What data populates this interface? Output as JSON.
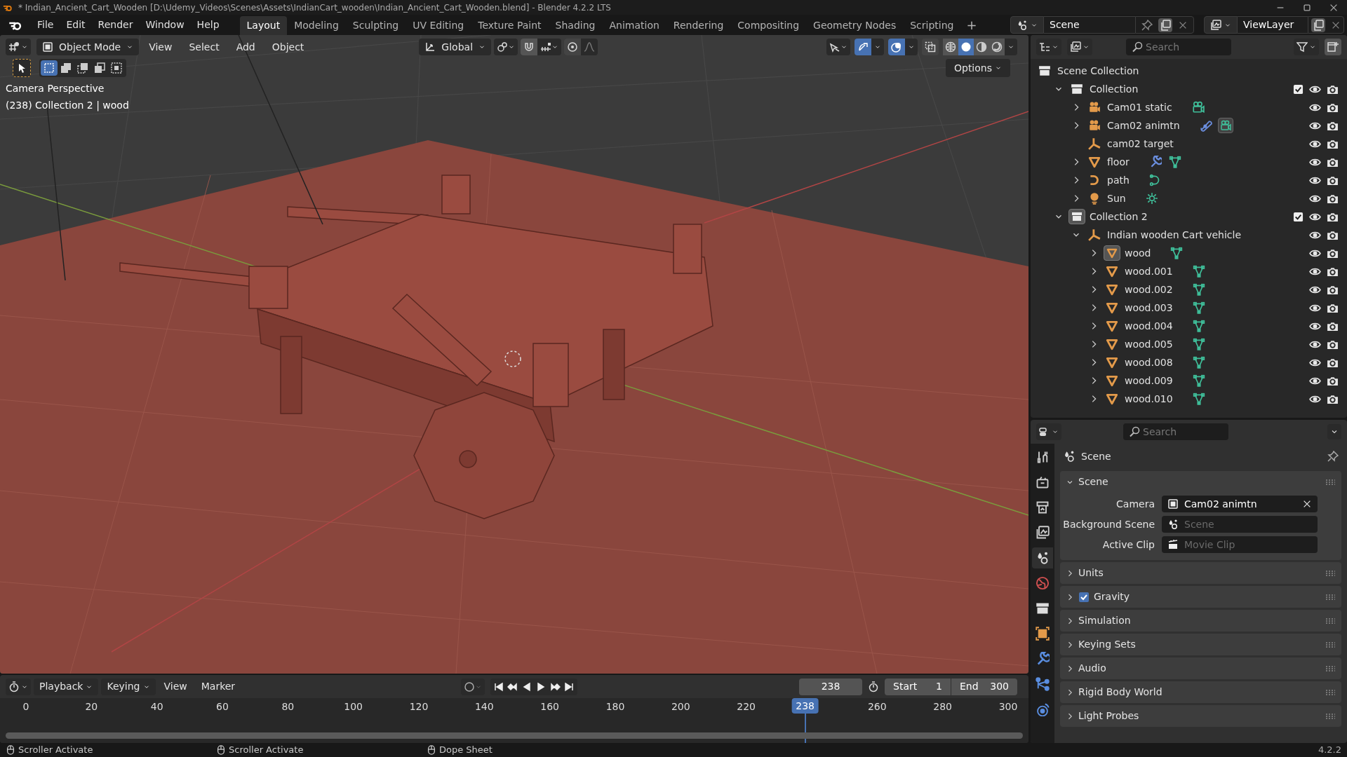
{
  "window": {
    "title": "* Indian_Ancient_Cart_Wooden [D:\\Udemy_Videos\\Scenes\\Assets\\IndianCart_wooden\\Indian_Ancient_Cart_Wooden.blend] - Blender 4.2.2 LTS"
  },
  "menu": [
    "File",
    "Edit",
    "Render",
    "Window",
    "Help"
  ],
  "workspaces": [
    {
      "label": "Layout",
      "selected": true
    },
    {
      "label": "Modeling",
      "selected": false
    },
    {
      "label": "Sculpting",
      "selected": false
    },
    {
      "label": "UV Editing",
      "selected": false
    },
    {
      "label": "Texture Paint",
      "selected": false
    },
    {
      "label": "Shading",
      "selected": false
    },
    {
      "label": "Animation",
      "selected": false
    },
    {
      "label": "Rendering",
      "selected": false
    },
    {
      "label": "Compositing",
      "selected": false
    },
    {
      "label": "Geometry Nodes",
      "selected": false
    },
    {
      "label": "Scripting",
      "selected": false
    }
  ],
  "add_workspace": "+",
  "scene": "Scene",
  "view_layer": "ViewLayer",
  "viewport": {
    "mode": "Object Mode",
    "menus": [
      "View",
      "Select",
      "Add",
      "Object"
    ],
    "orientation": "Global",
    "select_modes": [
      {
        "selected": true
      },
      {
        "selected": false
      },
      {
        "selected": false
      },
      {
        "selected": false
      },
      {
        "selected": false
      }
    ],
    "shading_modes": [
      {
        "kind": "wireframe",
        "selected": false
      },
      {
        "kind": "solid",
        "selected": true
      },
      {
        "kind": "material",
        "selected": false
      },
      {
        "kind": "rendered",
        "selected": false
      }
    ],
    "options": "Options",
    "info": [
      "Camera Perspective",
      "(238) Collection 2 | wood"
    ]
  },
  "outliner": {
    "search_placeholder": "Search",
    "tree": [
      {
        "label": "Scene Collection",
        "kind": "scene_collection",
        "active": false,
        "children": [
          {
            "label": "Collection",
            "kind": "collection",
            "active": false,
            "expanded": true,
            "checked": true,
            "children": [
              {
                "label": "Cam01 static",
                "kind": "camera",
                "active": false,
                "expanded": false,
                "extras": [
                  {
                    "kind": "camera_data",
                    "active": false
                  }
                ]
              },
              {
                "label": "Cam02 animtn",
                "kind": "camera",
                "active": false,
                "expanded": false,
                "extras": [
                  {
                    "kind": "constraint",
                    "active": false
                  },
                  {
                    "kind": "camera_data",
                    "active": true
                  }
                ]
              },
              {
                "label": "cam02 target",
                "kind": "empty",
                "active": false
              },
              {
                "label": "floor",
                "kind": "mesh",
                "active": false,
                "expanded": false,
                "extras": [
                  {
                    "kind": "modifier",
                    "active": false
                  },
                  {
                    "kind": "mesh_data",
                    "active": false
                  }
                ]
              },
              {
                "label": "path",
                "kind": "curve",
                "active": false,
                "expanded": false,
                "extras": [
                  {
                    "kind": "curve_data",
                    "active": false
                  }
                ]
              },
              {
                "label": "Sun",
                "kind": "light",
                "active": false,
                "expanded": false,
                "extras": [
                  {
                    "kind": "light_data",
                    "active": false
                  }
                ]
              }
            ]
          },
          {
            "label": "Collection 2",
            "kind": "collection",
            "active": true,
            "expanded": true,
            "checked": true,
            "children": [
              {
                "label": "Indian wooden Cart vehicle",
                "kind": "empty",
                "active": false,
                "expanded": true,
                "children": [
                  {
                    "label": "wood",
                    "kind": "mesh",
                    "active": true,
                    "expanded": false,
                    "extras": [
                      {
                        "kind": "mesh_data",
                        "active": false
                      }
                    ]
                  },
                  {
                    "label": "wood.001",
                    "kind": "mesh",
                    "active": false,
                    "expanded": false,
                    "extras": [
                      {
                        "kind": "mesh_data",
                        "active": false
                      }
                    ]
                  },
                  {
                    "label": "wood.002",
                    "kind": "mesh",
                    "active": false,
                    "expanded": false,
                    "extras": [
                      {
                        "kind": "mesh_data",
                        "active": false
                      }
                    ]
                  },
                  {
                    "label": "wood.003",
                    "kind": "mesh",
                    "active": false,
                    "expanded": false,
                    "extras": [
                      {
                        "kind": "mesh_data",
                        "active": false
                      }
                    ]
                  },
                  {
                    "label": "wood.004",
                    "kind": "mesh",
                    "active": false,
                    "expanded": false,
                    "extras": [
                      {
                        "kind": "mesh_data",
                        "active": false
                      }
                    ]
                  },
                  {
                    "label": "wood.005",
                    "kind": "mesh",
                    "active": false,
                    "expanded": false,
                    "extras": [
                      {
                        "kind": "mesh_data",
                        "active": false
                      }
                    ]
                  },
                  {
                    "label": "wood.008",
                    "kind": "mesh",
                    "active": false,
                    "expanded": false,
                    "extras": [
                      {
                        "kind": "mesh_data",
                        "active": false
                      }
                    ]
                  },
                  {
                    "label": "wood.009",
                    "kind": "mesh",
                    "active": false,
                    "expanded": false,
                    "extras": [
                      {
                        "kind": "mesh_data",
                        "active": false
                      }
                    ]
                  },
                  {
                    "label": "wood.010",
                    "kind": "mesh",
                    "active": false,
                    "expanded": false,
                    "extras": [
                      {
                        "kind": "mesh_data",
                        "active": false
                      }
                    ]
                  }
                ]
              }
            ]
          }
        ]
      }
    ]
  },
  "properties": {
    "search_placeholder": "Search",
    "tabs": [
      {
        "kind": "tool",
        "selected": false
      },
      {
        "kind": "render",
        "selected": false
      },
      {
        "kind": "output",
        "selected": false
      },
      {
        "kind": "view_layer",
        "selected": false
      },
      {
        "kind": "scene",
        "selected": true
      },
      {
        "kind": "world",
        "selected": false
      },
      {
        "kind": "collection",
        "selected": false
      },
      {
        "kind": "object",
        "selected": false
      },
      {
        "kind": "modifier",
        "selected": false
      },
      {
        "kind": "particles",
        "selected": false
      },
      {
        "kind": "physics",
        "selected": false
      }
    ],
    "context": "Scene",
    "panels": [
      {
        "label": "Scene",
        "expanded": true,
        "fields": [
          {
            "label": "Camera",
            "kind": "object",
            "value": "Cam02 animtn"
          },
          {
            "label": "Background Scene",
            "kind": "scene",
            "placeholder": "Scene"
          },
          {
            "label": "Active Clip",
            "kind": "clip",
            "placeholder": "Movie Clip"
          }
        ]
      },
      {
        "label": "Units",
        "expanded": false
      },
      {
        "label": "Gravity",
        "expanded": false,
        "checked": true
      },
      {
        "label": "Simulation",
        "expanded": false
      },
      {
        "label": "Keying Sets",
        "expanded": false
      },
      {
        "label": "Audio",
        "expanded": false
      },
      {
        "label": "Rigid Body World",
        "expanded": false
      },
      {
        "label": "Light Probes",
        "expanded": false
      }
    ]
  },
  "timeline": {
    "menus": [
      {
        "label": "Playback",
        "dropdown": true
      },
      {
        "label": "Keying",
        "dropdown": true
      },
      {
        "label": "View",
        "dropdown": false
      },
      {
        "label": "Marker",
        "dropdown": false
      }
    ],
    "current_frame": "238",
    "start_label": "Start",
    "start": "1",
    "end_label": "End",
    "end": "300",
    "ticks": [
      "0",
      "20",
      "40",
      "60",
      "80",
      "100",
      "120",
      "140",
      "160",
      "180",
      "200",
      "220",
      "260",
      "280",
      "300"
    ],
    "playhead": {
      "label": "238",
      "level": 0.7933
    }
  },
  "status_bar": {
    "hints": [
      "Scroller Activate",
      "Scroller Activate",
      "Dope Sheet"
    ],
    "version": "4.2.2"
  }
}
